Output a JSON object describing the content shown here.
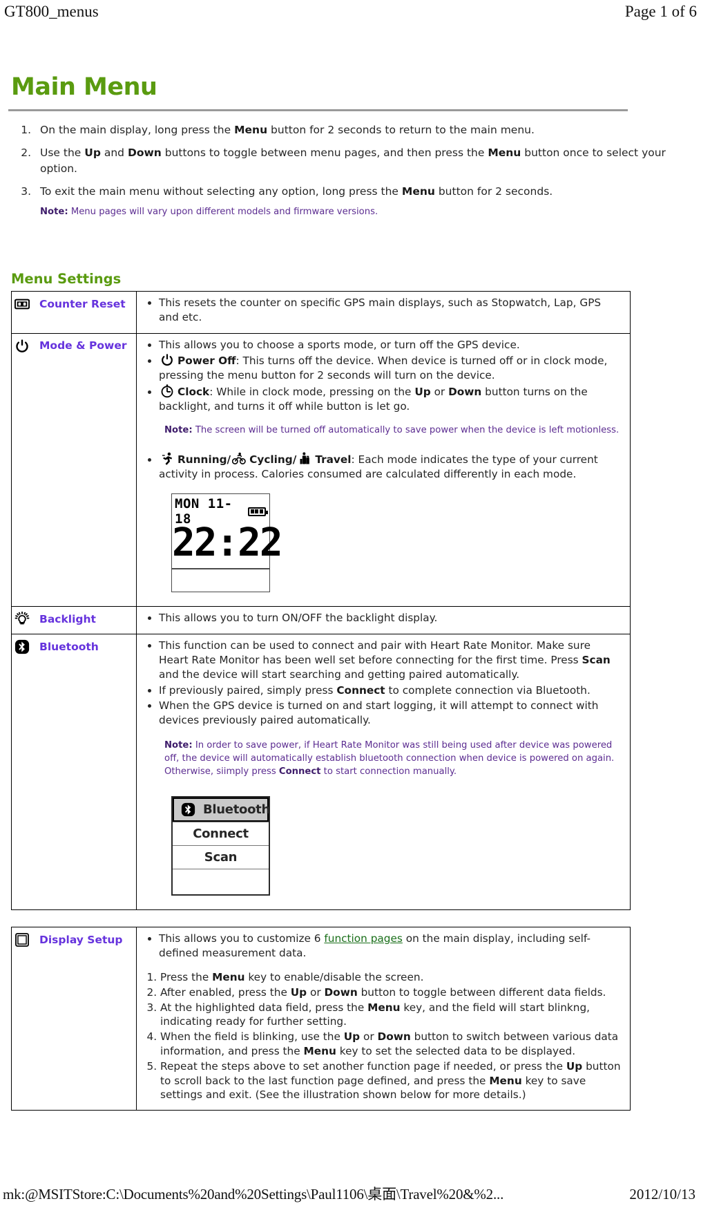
{
  "print_header": {
    "doc_name": "GT800_menus",
    "page_indicator": "Page 1 of 6"
  },
  "print_footer": {
    "url": "mk:@MSITStore:C:\\Documents%20and%20Settings\\Paul1106\\桌面\\Travel%20&%2...",
    "date": "2012/10/13"
  },
  "document": {
    "title": "Main Menu",
    "title_color": "#5a9b10",
    "steps": [
      {
        "parts": [
          {
            "t": "On the main display, long press the ",
            "b": false
          },
          {
            "t": "Menu",
            "b": true
          },
          {
            "t": " button for 2 seconds to return to the main menu.",
            "b": false
          }
        ]
      },
      {
        "parts": [
          {
            "t": "Use the ",
            "b": false
          },
          {
            "t": "Up",
            "b": true
          },
          {
            "t": " and ",
            "b": false
          },
          {
            "t": "Down",
            "b": true
          },
          {
            "t": " buttons to toggle between menu pages, and then press the ",
            "b": false
          },
          {
            "t": "Menu",
            "b": true
          },
          {
            "t": " button once to select your option.",
            "b": false
          }
        ]
      },
      {
        "parts": [
          {
            "t": "To exit the main menu without selecting any option, long press the ",
            "b": false
          },
          {
            "t": "Menu",
            "b": true
          },
          {
            "t": " button for 2 seconds.",
            "b": false
          }
        ]
      }
    ],
    "note_main": {
      "label": "Note:",
      "text": " Menu pages will vary upon different models and firmware versions."
    },
    "section_title": "Menu Settings",
    "note_color": "#5c2d91",
    "label_color": "#6633dd",
    "link_color": "#1a6f1a"
  },
  "settings_rows": [
    {
      "id": "counter-reset",
      "icon": "counter-00-icon",
      "label": "Counter Reset",
      "bullets": [
        [
          {
            "t": "This resets the counter on specific GPS main displays, such as Stopwatch, Lap, GPS and etc.",
            "b": false
          }
        ]
      ]
    },
    {
      "id": "mode-and-power",
      "icon": "power-icon",
      "label": "Mode & Power",
      "bullets": [
        [
          {
            "t": "This allows you to choose a sports mode, or turn off the GPS device.",
            "b": false
          }
        ],
        [
          {
            "icon": "power-icon"
          },
          {
            "t": "Power Off",
            "b": true
          },
          {
            "t": ": This turns off the device. When device is turned off or in clock mode, pressing the menu button for 2 seconds will turn on the device.",
            "b": false
          }
        ],
        [
          {
            "icon": "clock-icon"
          },
          {
            "t": "Clock",
            "b": true
          },
          {
            "t": ": While in clock mode, pressing on the ",
            "b": false
          },
          {
            "t": "Up",
            "b": true
          },
          {
            "t": " or ",
            "b": false
          },
          {
            "t": "Down",
            "b": true
          },
          {
            "t": " button turns on the backlight, and turns it off while button is let go.",
            "b": false
          }
        ]
      ],
      "note": {
        "label": "Note:",
        "text": " The screen will be turned off automatically to save power when the device is left motionless."
      },
      "bullets_after_note": [
        [
          {
            "icon": "running-icon"
          },
          {
            "t": "Running/",
            "b": true
          },
          {
            "icon": "cycling-icon"
          },
          {
            "t": "Cycling/",
            "b": true
          },
          {
            "icon": "travel-icon"
          },
          {
            "t": "Travel",
            "b": true
          },
          {
            "t": ": Each mode indicates the type of your current activity in process. Calories consumed are calculated differently in each mode.",
            "b": false
          }
        ]
      ],
      "lcd_clock": {
        "date": "MON 11-18",
        "time": "22:22",
        "battery": "battery-full-icon"
      }
    },
    {
      "id": "backlight",
      "icon": "lightbulb-icon",
      "label": "Backlight",
      "bullets": [
        [
          {
            "t": "This allows you to turn ON/OFF the backlight display.",
            "b": false
          }
        ]
      ]
    },
    {
      "id": "bluetooth",
      "icon": "bluetooth-icon",
      "label": "Bluetooth",
      "bullets": [
        [
          {
            "t": "This function can be used to connect and pair with Heart Rate Monitor. Make sure Heart Rate Monitor has been well set before connecting for the first time. Press ",
            "b": false
          },
          {
            "t": "Scan",
            "b": true
          },
          {
            "t": " and the device will start searching and getting paired automatically.",
            "b": false
          }
        ],
        [
          {
            "t": "If previously paired, simply press ",
            "b": false
          },
          {
            "t": "Connect",
            "b": true
          },
          {
            "t": " to complete connection via Bluetooth.",
            "b": false
          }
        ],
        [
          {
            "t": "When the GPS device is turned on and start logging, it will attempt to connect with devices previously paired automatically.",
            "b": false
          }
        ]
      ],
      "note": {
        "label": "Note:",
        "parts": [
          {
            "t": " In order to save power, if Heart Rate Monitor was still being used after device was powered off, the device will automatically establish bluetooth connection when device is powered on again. Otherwise, siimply press ",
            "b": false
          },
          {
            "t": "Connect",
            "b": true
          },
          {
            "t": " to start connection manually.",
            "b": false
          }
        ]
      },
      "lcd_menu": {
        "header": "Bluetooth",
        "header_icon": "bluetooth-icon",
        "items": [
          "Connect",
          "Scan",
          ""
        ]
      }
    }
  ],
  "display_setup": {
    "id": "display-setup",
    "icon": "display-square-icon",
    "label": "Display Setup",
    "bullets": [
      [
        {
          "t": "This allows you to customize 6 ",
          "b": false
        },
        {
          "t": "function pages",
          "link": true
        },
        {
          "t": " on the main display, including self-defined measurement data.",
          "b": false
        }
      ]
    ],
    "numbered": [
      [
        {
          "t": "Press the ",
          "b": false
        },
        {
          "t": "Menu",
          "b": true
        },
        {
          "t": " key to enable/disable the screen.",
          "b": false
        }
      ],
      [
        {
          "t": "After enabled, press the ",
          "b": false
        },
        {
          "t": "Up",
          "b": true
        },
        {
          "t": " or ",
          "b": false
        },
        {
          "t": "Down",
          "b": true
        },
        {
          "t": " button to toggle between different data fields.",
          "b": false
        }
      ],
      [
        {
          "t": "At the highlighted data field, press the ",
          "b": false
        },
        {
          "t": "Menu",
          "b": true
        },
        {
          "t": " key, and the field will start blinkng, indicating ready for further setting.",
          "b": false
        }
      ],
      [
        {
          "t": "When the field is blinking, use the ",
          "b": false
        },
        {
          "t": "Up",
          "b": true
        },
        {
          "t": " or ",
          "b": false
        },
        {
          "t": "Down",
          "b": true
        },
        {
          "t": " button to switch between various data information, and press the ",
          "b": false
        },
        {
          "t": "Menu",
          "b": true
        },
        {
          "t": " key to set the selected data to be displayed.",
          "b": false
        }
      ],
      [
        {
          "t": "Repeat the steps above to set another function page if needed, or press the ",
          "b": false
        },
        {
          "t": "Up",
          "b": true
        },
        {
          "t": " button to scroll back to the last function page defined, and press the ",
          "b": false
        },
        {
          "t": "Menu",
          "b": true
        },
        {
          "t": " key to save settings and exit. (See the illustration shown below for more details.)",
          "b": false
        }
      ]
    ]
  }
}
